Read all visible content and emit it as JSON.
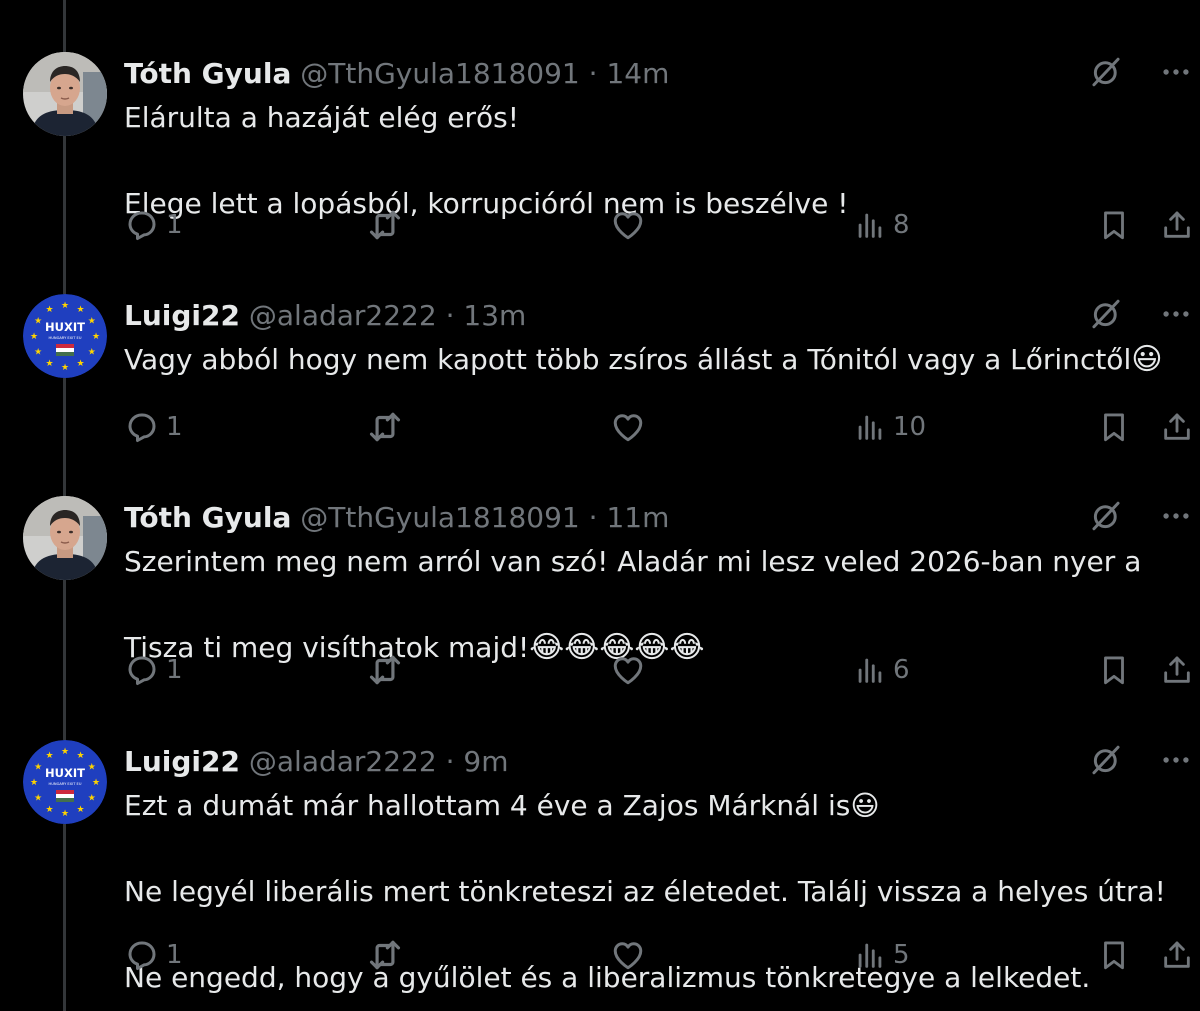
{
  "tweets": [
    {
      "name": "Tóth Gyula",
      "handle": "@TthGyula1818091",
      "dot": "·",
      "time": "14m",
      "avatar": "photo",
      "lines": [
        "Elárulta a hazáját elég erős!",
        "Elege lett a lopásból,  korrupcióról nem is beszélve !"
      ],
      "emoji_suffix": "",
      "reply_count": "1",
      "retweet_count": "",
      "like_count": "",
      "view_count": "8"
    },
    {
      "name": "Luigi22",
      "handle": "@aladar2222",
      "dot": "·",
      "time": "13m",
      "avatar": "huxit",
      "lines": [
        "Vagy abból hogy nem kapott több zsíros állást a Tónitól vagy a Lőrinctől"
      ],
      "emoji_suffix": "😃",
      "reply_count": "1",
      "retweet_count": "",
      "like_count": "",
      "view_count": "10"
    },
    {
      "name": "Tóth Gyula",
      "handle": "@TthGyula1818091",
      "dot": "·",
      "time": "11m",
      "avatar": "photo",
      "lines": [
        "Szerintem meg nem arról van szó! Aladár mi lesz veled 2026-ban nyer a",
        "Tisza ti meg visíthatok majd!"
      ],
      "emoji_suffix": "😂😂😂😂😂",
      "reply_count": "1",
      "retweet_count": "",
      "like_count": "",
      "view_count": "6"
    },
    {
      "name": "Luigi22",
      "handle": "@aladar2222",
      "dot": "·",
      "time": "9m",
      "avatar": "huxit",
      "lines": [
        "Ezt a dumát már hallottam 4 éve a Zajos Márknál is😃",
        "Ne legyél liberális mert tönkreteszi az életedet. Találj vissza a helyes útra!",
        "Ne engedd, hogy a gyűlölet és a liberalizmus tönkretegye a lelkedet."
      ],
      "emoji_suffix": "",
      "reply_count": "1",
      "retweet_count": "",
      "like_count": "",
      "view_count": "5"
    }
  ],
  "avatar_badge": {
    "text": "HUXIT",
    "subtext": "HUNGARY EXIT EU"
  },
  "icons": {
    "reply": "reply-icon",
    "retweet": "retweet-icon",
    "like": "heart-icon",
    "views": "views-icon",
    "bookmark": "bookmark-icon",
    "share": "share-icon",
    "grok": "grok-icon",
    "more": "more-icon"
  },
  "colors": {
    "background": "#000000",
    "text": "#e7e9ea",
    "muted": "#71767b",
    "thread_line": "#333639",
    "eu_blue": "#1f3fbf",
    "eu_star": "#ffd400"
  }
}
